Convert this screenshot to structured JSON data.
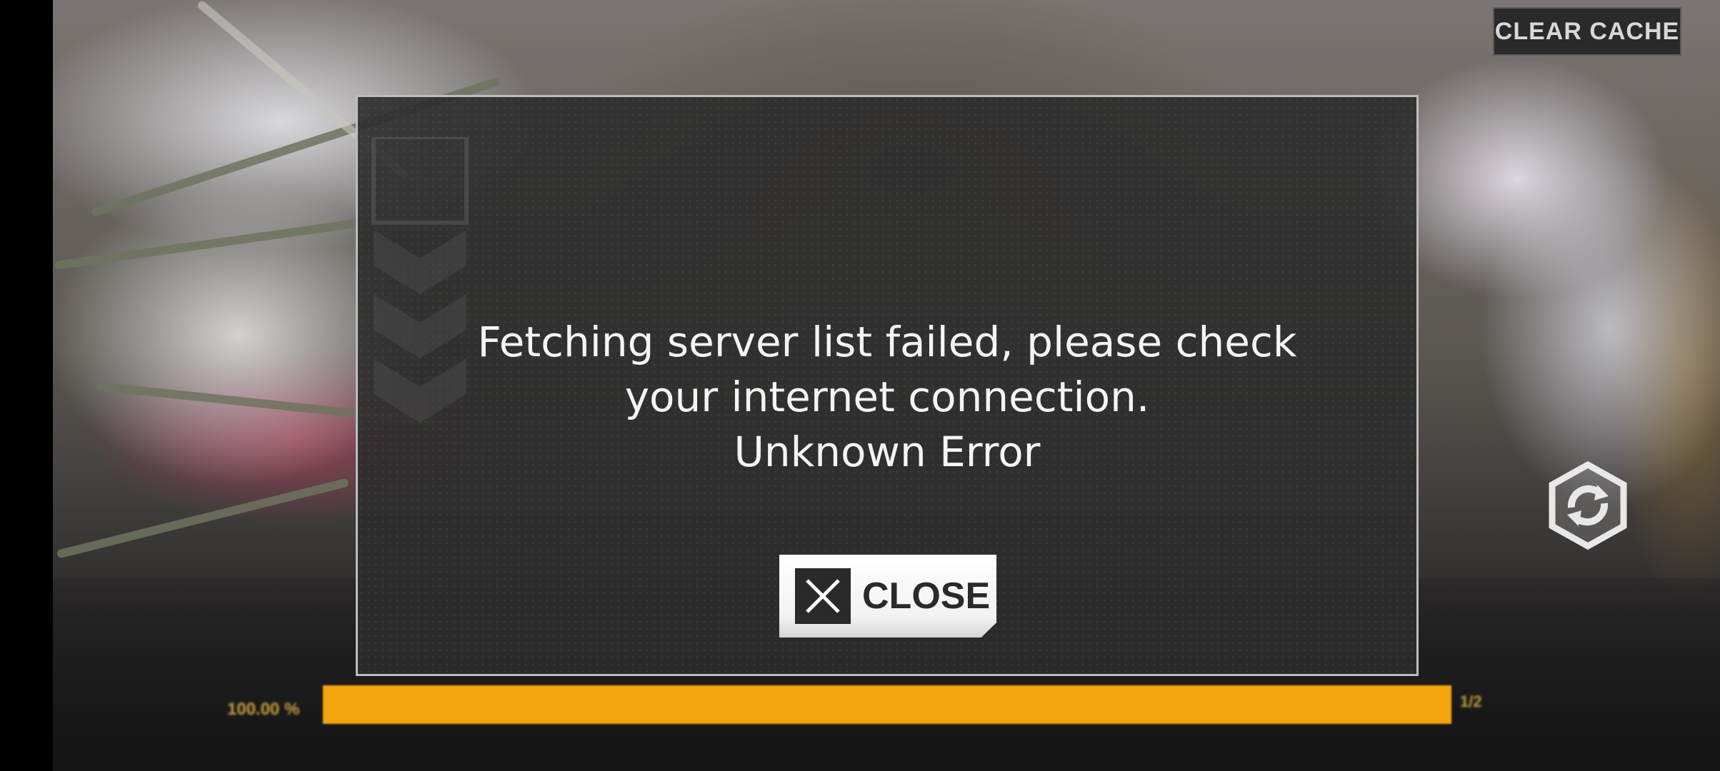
{
  "header": {
    "clear_cache_label": "CLEAR CACHE"
  },
  "dialog": {
    "message_line1": "Fetching server list failed, please check",
    "message_line2": "your internet connection.",
    "message_line3": "Unknown Error",
    "close_label": "CLOSE"
  },
  "loading": {
    "percent_text": "100.00 %",
    "progress_fraction": 1.0,
    "end_text": "1/2"
  },
  "icons": {
    "close": "close-x-icon",
    "refresh": "hexagon-refresh-icon",
    "emblem": "chevron-emblem-icon"
  },
  "colors": {
    "progress": "#f3a60d",
    "dialog_bg": "#2c2c2c",
    "dialog_border": "#bdbdbd"
  }
}
